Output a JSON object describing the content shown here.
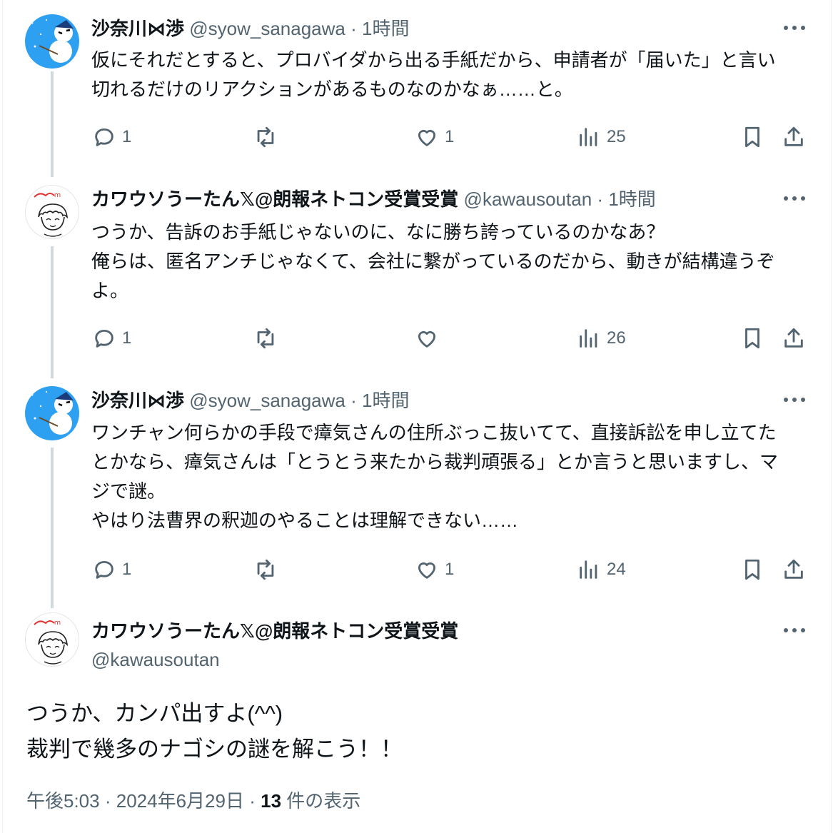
{
  "replies": [
    {
      "name": "沙奈川⋈渉",
      "handle": "@syow_sanagawa",
      "time": "1時間",
      "text": "仮にそれだとすると、プロバイダから出る手紙だから、申請者が「届いた」と言い\n切れるだけのリアクションがあるものなのかなぁ……と。",
      "replies": "1",
      "retweets": "",
      "likes": "1",
      "views": "25"
    },
    {
      "name": "カワウソうーたん𝕏@朗報ネトコン受賞受賞",
      "handle": "@kawausoutan",
      "time": "1時間",
      "text": "つうか、告訴のお手紙じゃないのに、なに勝ち誇っているのかなあ？\n俺らは、匿名アンチじゃなくて、会社に繋がっているのだから、動きが結構違うぞ\nよ。",
      "replies": "1",
      "retweets": "",
      "likes": "",
      "views": "26"
    },
    {
      "name": "沙奈川⋈渉",
      "handle": "@syow_sanagawa",
      "time": "1時間",
      "text": "ワンチャン何らかの手段で瘴気さんの住所ぶっこ抜いてて、直接訴訟を申し立てた\nとかなら、瘴気さんは「とうとう来たから裁判頑張る」とか言うと思いますし、マ\nジで謎。\nやはり法曹界の釈迦のやることは理解できない……",
      "replies": "1",
      "retweets": "",
      "likes": "1",
      "views": "24"
    }
  ],
  "main": {
    "name": "カワウソうーたん𝕏@朗報ネトコン受賞受賞",
    "handle": "@kawausoutan",
    "text": "つうか、カンパ出すよ(^^)\n裁判で幾多のナゴシの謎を解こう！！",
    "time": "午後5:03",
    "date": "2024年6月29日",
    "views": "13",
    "views_label": "件の表示"
  },
  "separator": "·",
  "colors": {
    "text": "#0f1419",
    "secondary": "#536471",
    "thread_line": "#cfd9de"
  },
  "icons": {
    "more": "more-horizontal-icon",
    "reply": "reply-icon",
    "retweet": "retweet-icon",
    "like": "heart-icon",
    "views": "analytics-icon",
    "bookmark": "bookmark-icon",
    "share": "share-icon"
  }
}
